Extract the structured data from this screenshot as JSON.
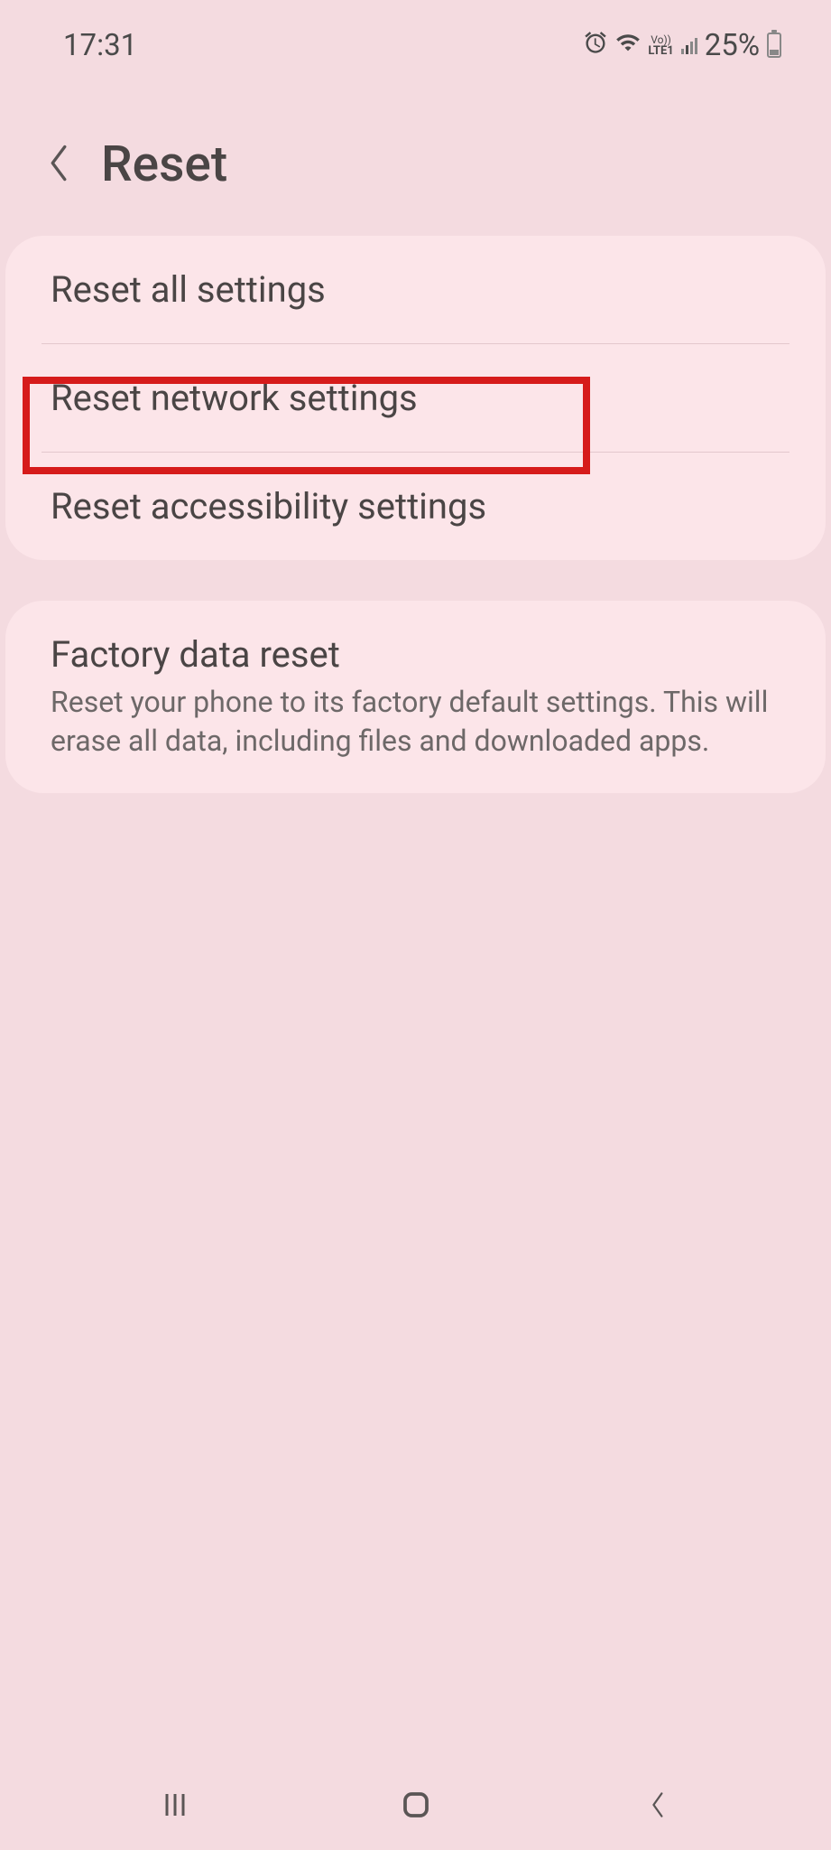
{
  "status_bar": {
    "time": "17:31",
    "lte_label": "Vo))",
    "lte_text": "LTE1",
    "battery_percent": "25%"
  },
  "header": {
    "title": "Reset"
  },
  "group1": {
    "items": [
      {
        "title": "Reset all settings"
      },
      {
        "title": "Reset network settings"
      },
      {
        "title": "Reset accessibility settings"
      }
    ]
  },
  "group2": {
    "items": [
      {
        "title": "Factory data reset",
        "description": "Reset your phone to its factory default settings. This will erase all data, including files and downloaded apps."
      }
    ]
  }
}
